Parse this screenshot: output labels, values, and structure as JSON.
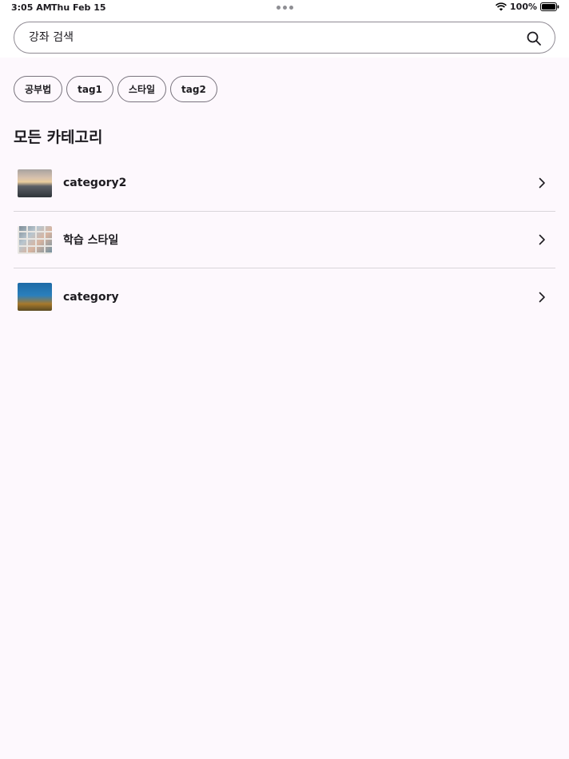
{
  "status_bar": {
    "time": "3:05 AM",
    "date": "Thu Feb 15",
    "battery": "100%"
  },
  "search": {
    "placeholder": "강좌 검색",
    "icon": "search-icon"
  },
  "chips": [
    {
      "label": "공부법"
    },
    {
      "label": "tag1"
    },
    {
      "label": "스타일"
    },
    {
      "label": "tag2"
    }
  ],
  "section": {
    "title": "모든 카테고리"
  },
  "categories": [
    {
      "label": "category2",
      "thumbnail": "sunset-sea"
    },
    {
      "label": "학습 스타일",
      "thumbnail": "photo-grid"
    },
    {
      "label": "category",
      "thumbnail": "ocean-diver"
    }
  ],
  "colors": {
    "background": "#fdf8fd",
    "outline": "#79747e",
    "divider": "#d9d5da",
    "text": "#1d1b20"
  }
}
